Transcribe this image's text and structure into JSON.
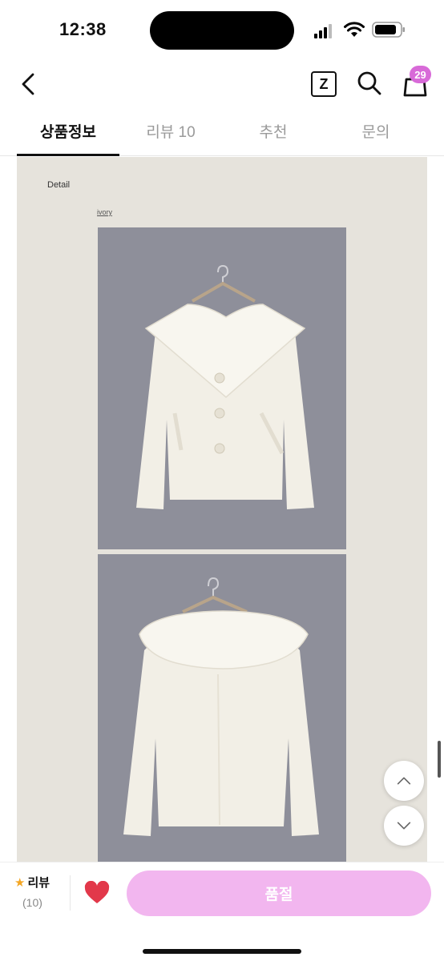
{
  "status_bar": {
    "time": "12:38"
  },
  "header": {
    "z_label": "Z",
    "cart_badge": "29"
  },
  "tabs": [
    {
      "label": "상품정보",
      "active": true
    },
    {
      "label": "리뷰 10",
      "active": false
    },
    {
      "label": "추천",
      "active": false
    },
    {
      "label": "문의",
      "active": false
    }
  ],
  "content": {
    "detail_label": "Detail",
    "color_label": "ivory"
  },
  "bottom_bar": {
    "review_label": "리뷰",
    "review_count": "(10)",
    "sold_out_label": "품절"
  },
  "colors": {
    "accent": "#d86ad8",
    "sold_out_button": "#f2b6ef",
    "heart": "#e2384a",
    "star": "#f4a623",
    "content_bg": "#e6e3dc",
    "photo_bg": "#8e8f9a"
  }
}
